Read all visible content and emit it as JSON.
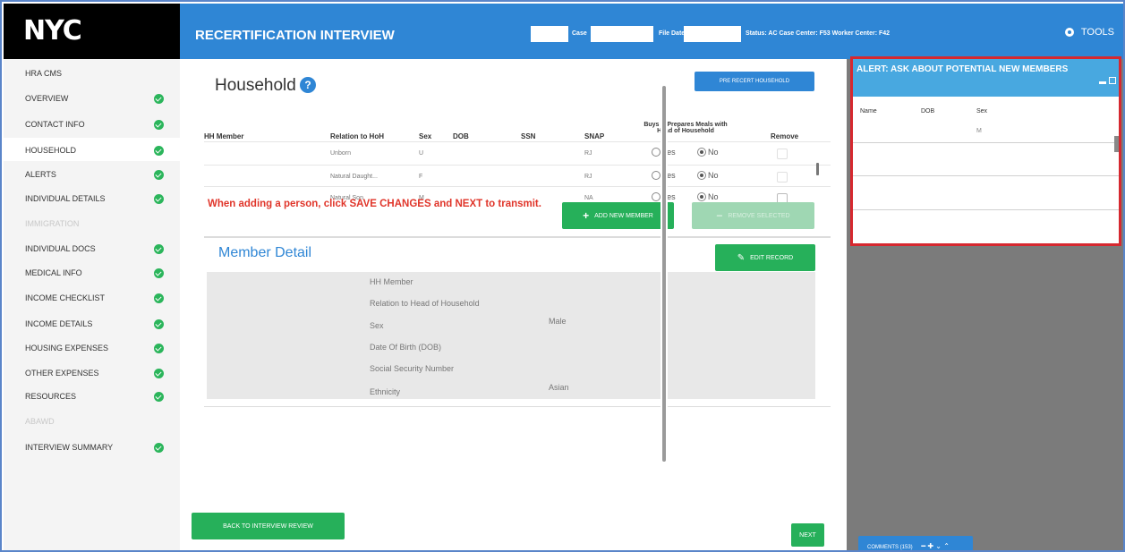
{
  "logo": "NYC",
  "header": {
    "title": "RECERTIFICATION INTERVIEW",
    "case_label": "Case",
    "file_date_label": "File Date",
    "status_text": "Status: AC Case Center: F53 Worker Center: F42",
    "tools_label": "TOOLS"
  },
  "sidebar": {
    "items": [
      {
        "label": "HRA CMS",
        "state": "header"
      },
      {
        "label": "OVERVIEW",
        "state": "done"
      },
      {
        "label": "CONTACT INFO",
        "state": "done"
      },
      {
        "label": "HOUSEHOLD",
        "state": "active"
      },
      {
        "label": "ALERTS",
        "state": "done"
      },
      {
        "label": "INDIVIDUAL DETAILS",
        "state": "done"
      },
      {
        "label": "IMMIGRATION",
        "state": "disabled"
      },
      {
        "label": "INDIVIDUAL DOCS",
        "state": "done"
      },
      {
        "label": "MEDICAL INFO",
        "state": "done"
      },
      {
        "label": "INCOME CHECKLIST",
        "state": "done"
      },
      {
        "label": "INCOME DETAILS",
        "state": "done"
      },
      {
        "label": "HOUSING EXPENSES",
        "state": "done"
      },
      {
        "label": "OTHER EXPENSES",
        "state": "done"
      },
      {
        "label": "RESOURCES",
        "state": "done"
      },
      {
        "label": "ABAWD",
        "state": "disabled"
      },
      {
        "label": "INTERVIEW SUMMARY",
        "state": "done"
      }
    ]
  },
  "household": {
    "title": "Household",
    "pre_recert_button": "PRE RECERT HOUSEHOLD",
    "columns": [
      "HH Member",
      "Relation to HoH",
      "Sex",
      "DOB",
      "SSN",
      "SNAP",
      "Buys & Prepares Meals with Head of Household",
      "Remove"
    ],
    "rows": [
      {
        "member": "",
        "relation": "Unborn",
        "sex": "U",
        "dob": "",
        "ssn": "",
        "snap": "RJ",
        "meals": "No"
      },
      {
        "member": "",
        "relation": "Natural Daught...",
        "sex": "F",
        "dob": "",
        "ssn": "",
        "snap": "RJ",
        "meals": "No"
      },
      {
        "member": "",
        "relation": "Natural Son",
        "sex": "M",
        "dob": "",
        "ssn": "",
        "snap": "NA",
        "meals": "No"
      }
    ],
    "yes_label": "Yes",
    "no_label": "No",
    "warning": "When adding a person, click SAVE CHANGES and NEXT to transmit.",
    "add_button": "ADD NEW MEMBER",
    "remove_button": "REMOVE SELECTED"
  },
  "member_detail": {
    "title": "Member Detail",
    "edit_button": "EDIT RECORD",
    "fields": [
      {
        "label": "HH Member",
        "value": ""
      },
      {
        "label": "Relation to Head of Household",
        "value": ""
      },
      {
        "label": "Sex",
        "value": "Male"
      },
      {
        "label": "Date Of Birth (DOB)",
        "value": ""
      },
      {
        "label": "Social Security Number",
        "value": ""
      },
      {
        "label": "Ethnicity",
        "value": "Asian"
      }
    ]
  },
  "footer": {
    "back_button": "BACK TO INTERVIEW REVIEW",
    "next_button": "NEXT"
  },
  "alert_panel": {
    "title": "ALERT: ASK ABOUT POTENTIAL NEW MEMBERS",
    "columns": [
      "Name",
      "DOB",
      "Sex"
    ],
    "rows": [
      {
        "name": "",
        "dob": "",
        "sex": "M"
      }
    ]
  },
  "comments": {
    "label": "COMMENTS (153)"
  },
  "colors": {
    "header_blue": "#2f86d5",
    "success_green": "#26b05a",
    "warning_red": "#e0352a",
    "alert_border": "#d6282f"
  }
}
